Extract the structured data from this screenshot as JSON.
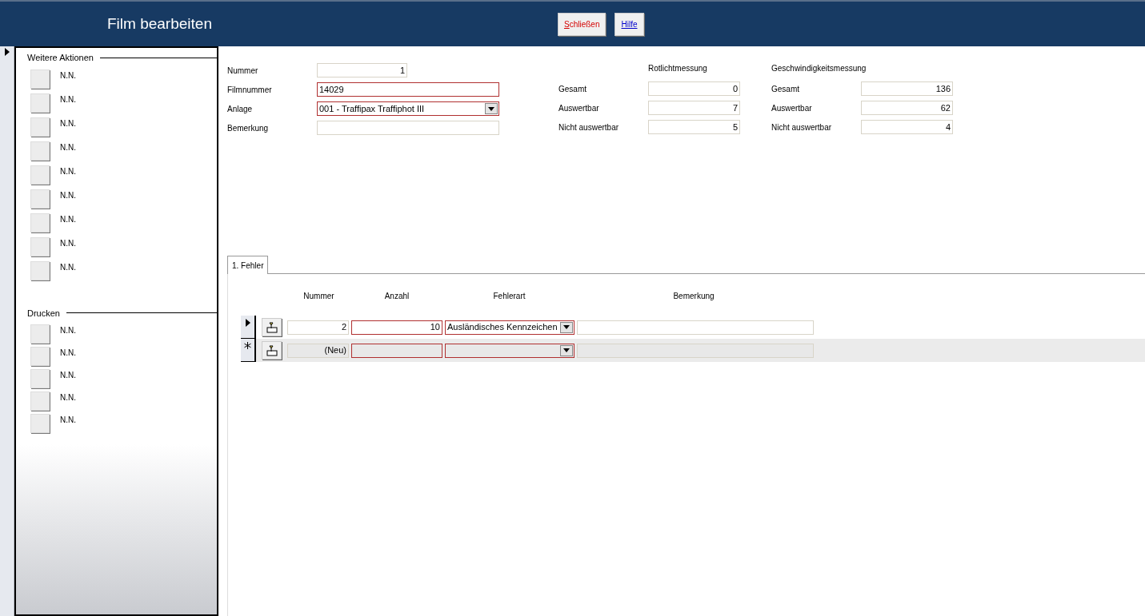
{
  "header": {
    "title": "Film bearbeiten",
    "buttons": [
      {
        "label": "Schließen",
        "kind": "accesskey"
      },
      {
        "label": "Hilfe",
        "kind": "link"
      }
    ]
  },
  "sidebar": {
    "groups": [
      {
        "title": "Weitere Aktionen",
        "items": [
          "N.N.",
          "N.N.",
          "N.N.",
          "N.N.",
          "N.N.",
          "N.N.",
          "N.N.",
          "N.N.",
          "N.N."
        ]
      },
      {
        "title": "Drucken",
        "items": [
          "N.N.",
          "N.N.",
          "N.N.",
          "N.N.",
          "N.N."
        ]
      }
    ]
  },
  "form": {
    "fields": [
      {
        "label": "Nummer",
        "value": "1",
        "kind": "short",
        "required": false
      },
      {
        "label": "Filmnummer",
        "value": "14029",
        "kind": "text",
        "required": true
      },
      {
        "label": "Anlage",
        "value": "001 - Traffipax Traffiphot III",
        "kind": "combo",
        "required": true
      },
      {
        "label": "Bemerkung",
        "kind": "text",
        "required": false
      }
    ]
  },
  "counters": [
    {
      "title": "Rotlichtmessung",
      "rows": [
        {
          "label": "Gesamt",
          "value": "0"
        },
        {
          "label": "Auswertbar",
          "value": "7"
        },
        {
          "label": "Nicht auswertbar",
          "value": "5"
        }
      ]
    },
    {
      "title": "Geschwindigkeitsmessung",
      "rows": [
        {
          "label": "Gesamt",
          "value": "136"
        },
        {
          "label": "Auswertbar",
          "value": "62"
        },
        {
          "label": "Nicht auswertbar",
          "value": "4"
        }
      ]
    }
  ],
  "tabs": [
    {
      "label": "1. Fehler",
      "selected": true
    }
  ],
  "grid": {
    "columns": [
      "Nummer",
      "Anzahl",
      "Fehlerart",
      "Bemerkung"
    ],
    "rows": [
      {
        "current": true,
        "new": false,
        "nummer": "2",
        "anzahl": "10",
        "fehlerart": "Ausländisches Kennzeichen"
      },
      {
        "current": false,
        "new": true,
        "nummer": "(Neu)"
      }
    ]
  }
}
